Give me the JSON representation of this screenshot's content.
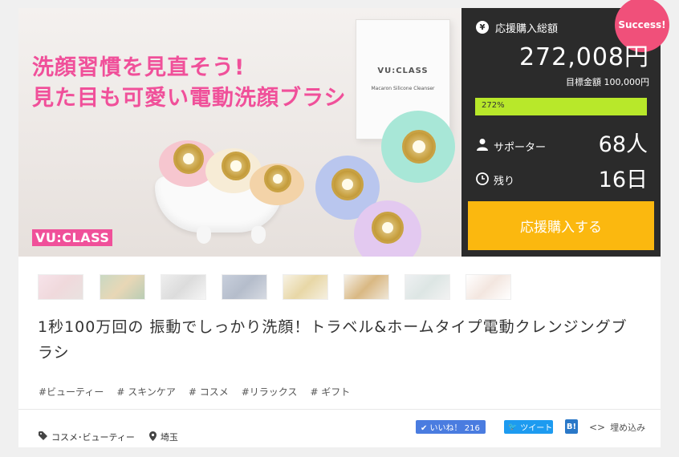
{
  "hero": {
    "headline_line1": "洗顔習慣を見直そう!",
    "headline_line2": "見た目も可愛い電動洗顔ブラシ",
    "brand_logo": "VU:CLASS",
    "box_brand": "VU:CLASS",
    "box_product": "Macaron Silicone Cleanser"
  },
  "sidebar": {
    "badge": "Success!",
    "total_label": "応援購入総額",
    "total_amount": "272,008円",
    "goal": "目標金額 100,000円",
    "progress_text": "272%",
    "progress_percent": 100,
    "supporters_label": "サポーター",
    "supporters_value": "68人",
    "remaining_label": "残り",
    "remaining_value": "16日",
    "buy_button": "応援購入する",
    "colors": {
      "accent": "#fbb80f",
      "progress": "#b8e82a",
      "badge": "#f0507a",
      "panel": "#2b2b2b"
    }
  },
  "thumbnails": [
    "thumb-1",
    "thumb-2",
    "thumb-3",
    "thumb-4",
    "thumb-5",
    "thumb-6",
    "thumb-7",
    "thumb-8"
  ],
  "title": "1秒100万回の 振動でしっかり洗顔！トラベル&ホームタイプ電動クレンジングブラシ",
  "tags": [
    "#ビューティー",
    "# スキンケア",
    "# コスメ",
    "#リラックス",
    "# ギフト"
  ],
  "footer": {
    "category": "コスメ･ビューティー",
    "location": "埼玉",
    "like_label": "✔ いいね！ 216",
    "tweet_label": "ツイート",
    "hatena_label": "B!",
    "embed_label": "埋め込み"
  }
}
